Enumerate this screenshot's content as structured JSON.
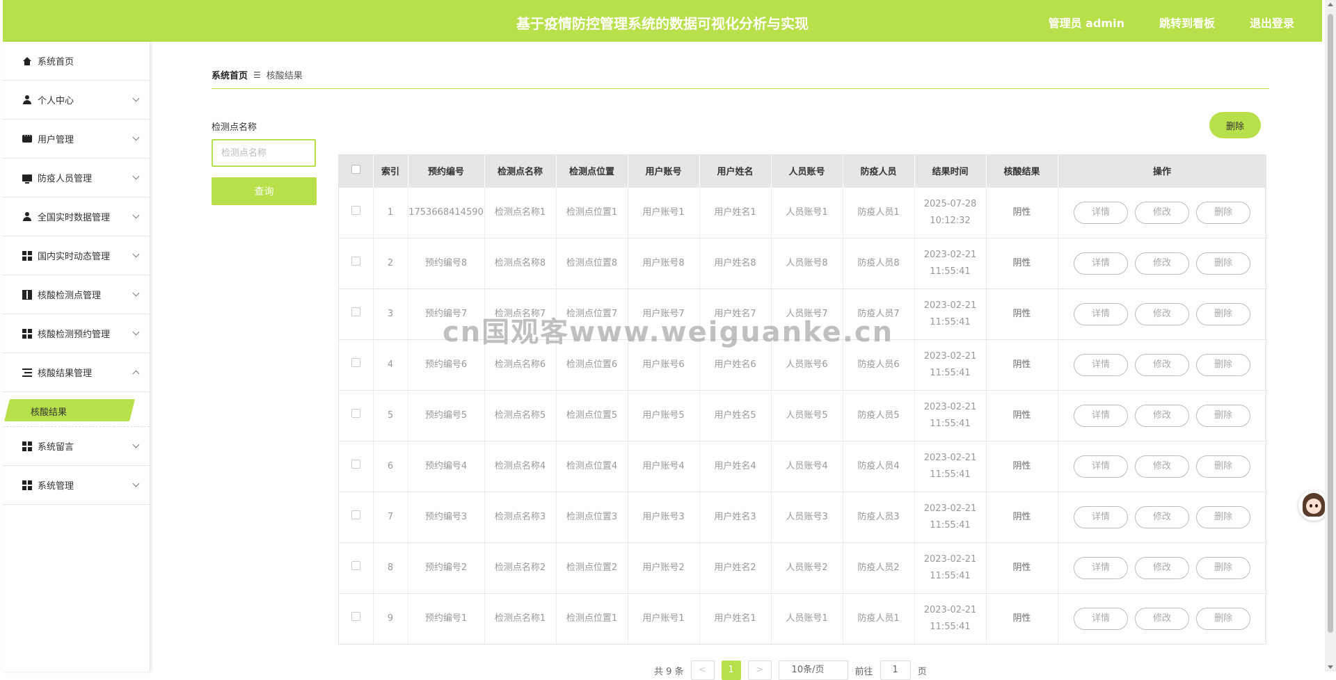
{
  "header": {
    "title": "基于疫情防控管理系统的数据可视化分析与实现",
    "admin_label": "管理员 admin",
    "board_link": "跳转到看板",
    "logout_link": "退出登录"
  },
  "sidebar": {
    "items": [
      {
        "label": "系统首页",
        "icon": "home-icon"
      },
      {
        "label": "个人中心",
        "icon": "user-icon"
      },
      {
        "label": "用户管理",
        "icon": "chat-icon"
      },
      {
        "label": "防疫人员管理",
        "icon": "monitor-icon"
      },
      {
        "label": "全国实时数据管理",
        "icon": "user-icon"
      },
      {
        "label": "国内实时动态管理",
        "icon": "grid-icon"
      },
      {
        "label": "核酸检测点管理",
        "icon": "book-icon"
      },
      {
        "label": "核酸检测预约管理",
        "icon": "grid-icon"
      },
      {
        "label": "核酸结果管理",
        "icon": "list-icon"
      },
      {
        "label": "系统留言",
        "icon": "grid-icon"
      },
      {
        "label": "系统管理",
        "icon": "grid-icon"
      }
    ],
    "active_sub": "核酸结果"
  },
  "breadcrumb": {
    "home": "系统首页",
    "sep": "☰",
    "current": "核酸结果"
  },
  "search": {
    "label": "检测点名称",
    "placeholder": "检测点名称",
    "value": "",
    "button": "查询"
  },
  "delete_button": "删除",
  "table": {
    "columns": [
      "索引",
      "预约编号",
      "检测点名称",
      "检测点位置",
      "用户账号",
      "用户姓名",
      "人员账号",
      "防疫人员",
      "结果时间",
      "核酸结果",
      "操作"
    ],
    "actions": [
      "详情",
      "修改",
      "删除"
    ],
    "rows": [
      {
        "index": "1",
        "booking": "1753668414590",
        "site": "检测点名称1",
        "location": "检测点位置1",
        "account": "用户账号1",
        "name": "用户姓名1",
        "staff_account": "人员账号1",
        "staff": "防疫人员1",
        "date": "2025-07-28",
        "time": "10:12:32",
        "result": "阴性"
      },
      {
        "index": "2",
        "booking": "预约编号8",
        "site": "检测点名称8",
        "location": "检测点位置8",
        "account": "用户账号8",
        "name": "用户姓名8",
        "staff_account": "人员账号8",
        "staff": "防疫人员8",
        "date": "2023-02-21",
        "time": "11:55:41",
        "result": "阴性"
      },
      {
        "index": "3",
        "booking": "预约编号7",
        "site": "检测点名称7",
        "location": "检测点位置7",
        "account": "用户账号7",
        "name": "用户姓名7",
        "staff_account": "人员账号7",
        "staff": "防疫人员7",
        "date": "2023-02-21",
        "time": "11:55:41",
        "result": "阴性"
      },
      {
        "index": "4",
        "booking": "预约编号6",
        "site": "检测点名称6",
        "location": "检测点位置6",
        "account": "用户账号6",
        "name": "用户姓名6",
        "staff_account": "人员账号6",
        "staff": "防疫人员6",
        "date": "2023-02-21",
        "time": "11:55:41",
        "result": "阴性"
      },
      {
        "index": "5",
        "booking": "预约编号5",
        "site": "检测点名称5",
        "location": "检测点位置5",
        "account": "用户账号5",
        "name": "用户姓名5",
        "staff_account": "人员账号5",
        "staff": "防疫人员5",
        "date": "2023-02-21",
        "time": "11:55:41",
        "result": "阴性"
      },
      {
        "index": "6",
        "booking": "预约编号4",
        "site": "检测点名称4",
        "location": "检测点位置4",
        "account": "用户账号4",
        "name": "用户姓名4",
        "staff_account": "人员账号4",
        "staff": "防疫人员4",
        "date": "2023-02-21",
        "time": "11:55:41",
        "result": "阴性"
      },
      {
        "index": "7",
        "booking": "预约编号3",
        "site": "检测点名称3",
        "location": "检测点位置3",
        "account": "用户账号3",
        "name": "用户姓名3",
        "staff_account": "人员账号3",
        "staff": "防疫人员3",
        "date": "2023-02-21",
        "time": "11:55:41",
        "result": "阴性"
      },
      {
        "index": "8",
        "booking": "预约编号2",
        "site": "检测点名称2",
        "location": "检测点位置2",
        "account": "用户账号2",
        "name": "用户姓名2",
        "staff_account": "人员账号2",
        "staff": "防疫人员2",
        "date": "2023-02-21",
        "time": "11:55:41",
        "result": "阴性"
      },
      {
        "index": "9",
        "booking": "预约编号1",
        "site": "检测点名称1",
        "location": "检测点位置1",
        "account": "用户账号1",
        "name": "用户姓名1",
        "staff_account": "人员账号1",
        "staff": "防疫人员1",
        "date": "2023-02-21",
        "time": "11:55:41",
        "result": "阴性"
      }
    ]
  },
  "pagination": {
    "total": "共 9 条",
    "prev": "<",
    "current": "1",
    "next": ">",
    "page_size": "10条/页",
    "goto_label": "前往",
    "goto_value": "1",
    "page_suffix": "页"
  },
  "watermark": "cn国观客www.weiguanke.cn",
  "colors": {
    "accent": "#b8e04a",
    "header_text": "#ffffff"
  }
}
